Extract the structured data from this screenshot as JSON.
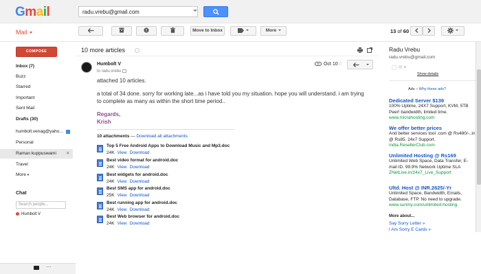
{
  "header": {
    "logo_letters": [
      "G",
      "m",
      "a",
      "i",
      "l"
    ],
    "search_value": "radu.vrebu@gmail.com"
  },
  "toolbar": {
    "mail_label": "Mail",
    "move_to_inbox": "Move to Inbox",
    "more": "More",
    "count_current": "13",
    "count_sep": " of ",
    "count_total": "60"
  },
  "sidebar": {
    "compose": "COMPOSE",
    "items": [
      {
        "label": "Inbox (7)",
        "bold": true
      },
      {
        "label": "Buzz"
      },
      {
        "label": "Starred"
      },
      {
        "label": "Important"
      },
      {
        "label": "Sent Mail"
      },
      {
        "label": "Drafts (30)",
        "bold": true
      },
      {
        "label": "humbolt.venag@yaho..."
      },
      {
        "label": "Personal"
      },
      {
        "label": "Raman kuppuswami"
      },
      {
        "label": "Travel"
      },
      {
        "label": "More"
      }
    ],
    "chat_label": "Chat",
    "chat_search_placeholder": "Search people...",
    "chat_user": "Humbolt V"
  },
  "message": {
    "subject": "10 more articles",
    "sender": "Humbolt V",
    "to": "to radu.vrebu",
    "date": "Oct 10",
    "body_lines": [
      "attached 10 articles.",
      "a total of 34 done. sorry for working late...as i have told you my situation. hope you will understand.  i am trying",
      "to complete as many as within the short time period.."
    ],
    "signature": [
      "Regards,",
      "Krish"
    ],
    "attachments_count": "10 attachments",
    "attachments_dash": " — ",
    "download_all": "Download all attachments",
    "view_label": "View",
    "download_label": "Download",
    "attachments": [
      {
        "name": "Top 5 Free Android Apps to Download Music and Mp3.doc",
        "size": "24K"
      },
      {
        "name": "Best video format for android.doc",
        "size": "24K"
      },
      {
        "name": "Best widgets for android.doc",
        "size": "24K"
      },
      {
        "name": "Best SMS app for android.doc",
        "size": "25K"
      },
      {
        "name": "Best running app for android.doc",
        "size": "24K"
      },
      {
        "name": "Best Web browser for android.doc",
        "size": "24K"
      }
    ]
  },
  "right_panel": {
    "name": "Radu Vrebu",
    "email": "radu.vrebu@gmail.com",
    "show_details": "Show details",
    "ads_prefix": "Ads – ",
    "ads_link": "Why these ads?",
    "ads": [
      {
        "title": "Dedicated Server $139",
        "desc": "100% Uptime, 24X7 Support, KVM, 5TB Peer! bandwidth, limited time.",
        "url": "www.micrahosting.com"
      },
      {
        "title": "We offer better prices",
        "desc": "And better services tool .com @ Rs480/-..in @ Rs85. 24x7 Support.",
        "url": "india.ResellerClub.com"
      },
      {
        "title": "Unlimited Hosting @ Rs169",
        "desc": "Unlimited Web Space, Data Transfer, E-mail ID. 99.9% Network Uptime SLA",
        "url": "ZNetLive.in/24x7_Live_Support"
      },
      {
        "title": "Ultd. Host @ INR.2625/-Yr",
        "desc": "Unlimited Space, Bandwidth, Emails, Database, FTP. No need to upgrade.",
        "url": "www.sunmy.com/unlimited-hosting"
      }
    ],
    "more_about": "More about...",
    "more_links": [
      "Say Sorry Letter »",
      "I Am Sorry E Cards »"
    ]
  }
}
